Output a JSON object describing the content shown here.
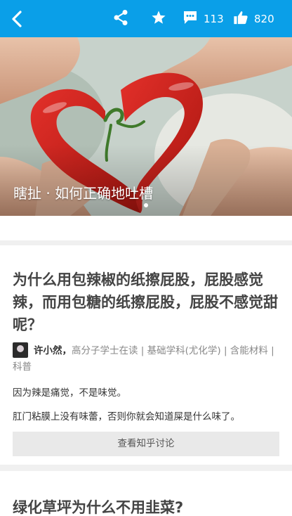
{
  "topbar": {
    "comment_count": "113",
    "like_count": "820"
  },
  "hero": {
    "title": "瞎扯 · 如何正确地吐槽"
  },
  "questions": [
    {
      "title": "为什么用包辣椒的纸擦屁股，屁股感觉辣，而用包糖的纸擦屁股，屁股不感觉甜呢？",
      "author_name": "许小然，",
      "author_bio": "高分子学士在读 | 基础学科(尤化学) | 含能材料 | 科普",
      "answer_lines": [
        "因为辣是痛觉，不是味觉。",
        "肛门粘膜上没有味蕾，否则你就会知道屎是什么味了。"
      ],
      "discuss_label": "查看知乎讨论"
    },
    {
      "title": "绿化草坪为什么不用韭菜?"
    }
  ],
  "colors": {
    "topbar": "#0a9fe8",
    "title_text": "#444444",
    "button_bg": "#e9e9e9"
  }
}
